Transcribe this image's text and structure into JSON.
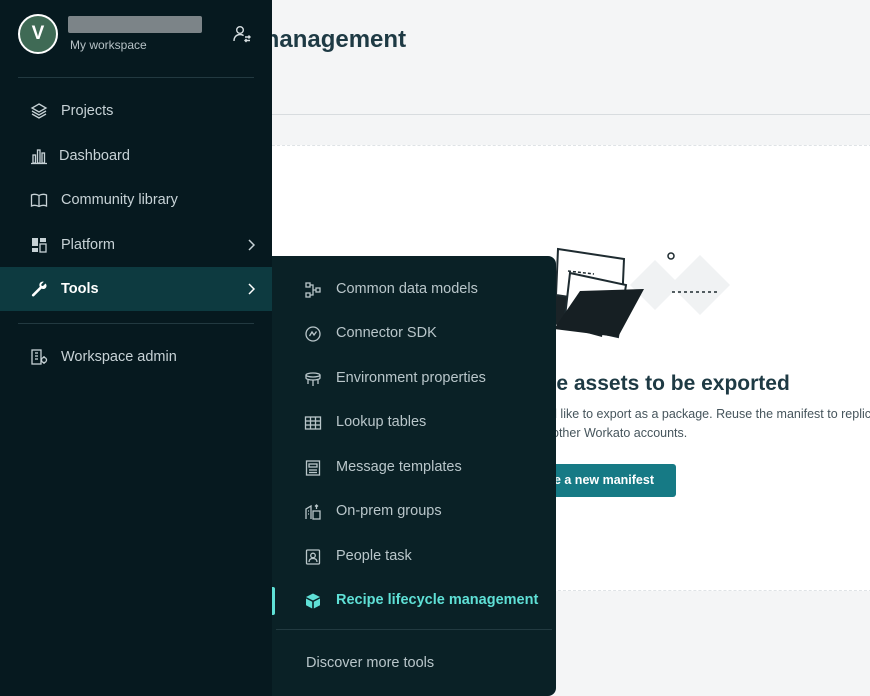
{
  "page": {
    "title": "e management",
    "card_heading": "efines the assets to be exported",
    "card_text_line1": "d like to export as a package. Reuse the manifest to replica",
    "card_text_line2": "other Workato accounts.",
    "card_button": "te a new manifest"
  },
  "workspace": {
    "avatar_letter": "V",
    "subtitle": "My workspace"
  },
  "nav": {
    "projects": "Projects",
    "dashboard": "Dashboard",
    "community": "Community library",
    "platform": "Platform",
    "tools": "Tools",
    "admin": "Workspace admin"
  },
  "tools_menu": {
    "items": [
      {
        "label": "Common data models",
        "icon": "data-model-icon"
      },
      {
        "label": "Connector SDK",
        "icon": "sdk-icon"
      },
      {
        "label": "Environment properties",
        "icon": "environment-icon"
      },
      {
        "label": "Lookup tables",
        "icon": "table-icon"
      },
      {
        "label": "Message templates",
        "icon": "template-icon"
      },
      {
        "label": "On-prem groups",
        "icon": "onprem-icon"
      },
      {
        "label": "People task",
        "icon": "person-badge-icon"
      },
      {
        "label": "Recipe lifecycle management",
        "icon": "cube-icon"
      }
    ],
    "active_index": 7,
    "discover": "Discover more tools"
  },
  "colors": {
    "sidebar_bg": "#06191f",
    "submenu_bg": "#0a2126",
    "active_accent": "#5fe0d6",
    "primary_button": "#167a85",
    "title_text": "#1e3a44"
  }
}
